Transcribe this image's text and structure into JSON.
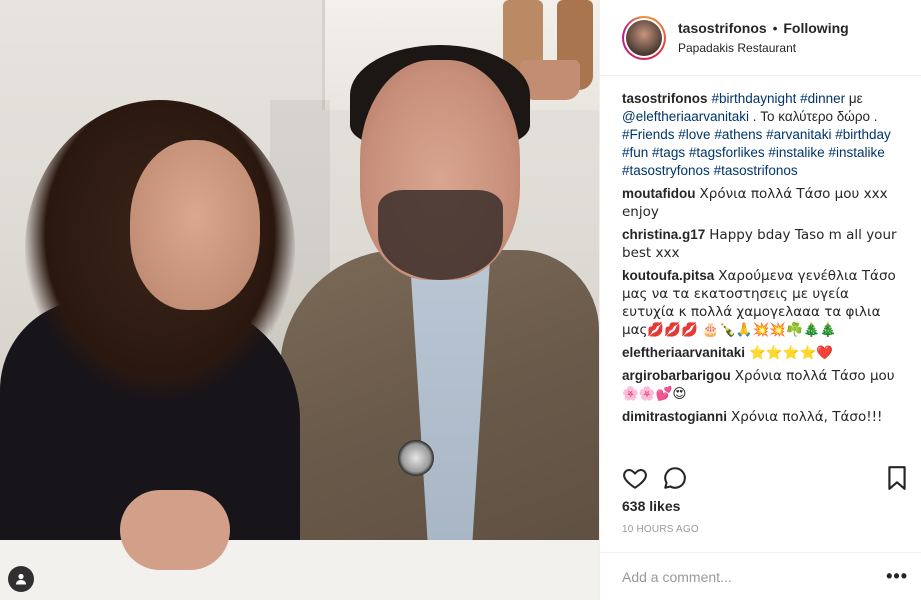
{
  "post": {
    "username": "tasostrifonos",
    "separator": "•",
    "follow_status": "Following",
    "location": "Papadakis Restaurant"
  },
  "caption": {
    "username": "tasostrifonos",
    "parts": [
      {
        "text": "#birthdaynight",
        "tag": true
      },
      {
        "text": " ",
        "tag": false
      },
      {
        "text": "#dinner",
        "tag": true
      },
      {
        "text": " με ",
        "tag": false
      },
      {
        "text": "@eleftheriaarvanitaki",
        "tag": true
      },
      {
        "text": " . Το καλύτερο δώρο . ",
        "tag": false
      },
      {
        "text": "#Friends",
        "tag": true
      },
      {
        "text": " ",
        "tag": false
      },
      {
        "text": "#love",
        "tag": true
      },
      {
        "text": " ",
        "tag": false
      },
      {
        "text": "#athens",
        "tag": true
      },
      {
        "text": " ",
        "tag": false
      },
      {
        "text": "#arvanitaki",
        "tag": true
      },
      {
        "text": " ",
        "tag": false
      },
      {
        "text": "#birthday",
        "tag": true
      },
      {
        "text": " ",
        "tag": false
      },
      {
        "text": "#fun",
        "tag": true
      },
      {
        "text": " ",
        "tag": false
      },
      {
        "text": "#tags",
        "tag": true
      },
      {
        "text": " ",
        "tag": false
      },
      {
        "text": "#tagsforlikes",
        "tag": true
      },
      {
        "text": " ",
        "tag": false
      },
      {
        "text": "#instalike",
        "tag": true
      },
      {
        "text": " ",
        "tag": false
      },
      {
        "text": "#instalike",
        "tag": true
      },
      {
        "text": " ",
        "tag": false
      },
      {
        "text": "#tasostryfonos",
        "tag": true
      },
      {
        "text": " ",
        "tag": false
      },
      {
        "text": "#tasostrifonos",
        "tag": true
      }
    ]
  },
  "comments": [
    {
      "user": "moutafidou",
      "text": "Χρόνια πολλά Τάσο μου xxx enjoy"
    },
    {
      "user": "christina.g17",
      "text": "Happy bday Taso m all your best xxx"
    },
    {
      "user": "koutoufa.pitsa",
      "text": "Χαρούμενα γενέθλια Τάσο μας να τα εκατοστησεις με υγεία ευτυχία κ πολλά χαμογελααα τα φιλια μας💋💋💋 🎂🍾🙏💥💥☘️🎄🎄"
    },
    {
      "user": "eleftheriaarvanitaki",
      "text": "⭐️⭐️⭐️⭐️❤️"
    },
    {
      "user": "argirobarbarigou",
      "text": "Χρόνια πολλά Τάσο μου 🌸🌸💕😍"
    },
    {
      "user": "dimitrastogianni",
      "text": "Χρόνια πολλά, Τάσο!!!"
    }
  ],
  "actions": {
    "like_icon": "heart-outline-icon",
    "comment_icon": "comment-bubble-icon",
    "save_icon": "bookmark-icon"
  },
  "likes_text": "638 likes",
  "time_text": "10 HOURS AGO",
  "add_comment": {
    "placeholder": "Add a comment..."
  },
  "more_label": "•••"
}
